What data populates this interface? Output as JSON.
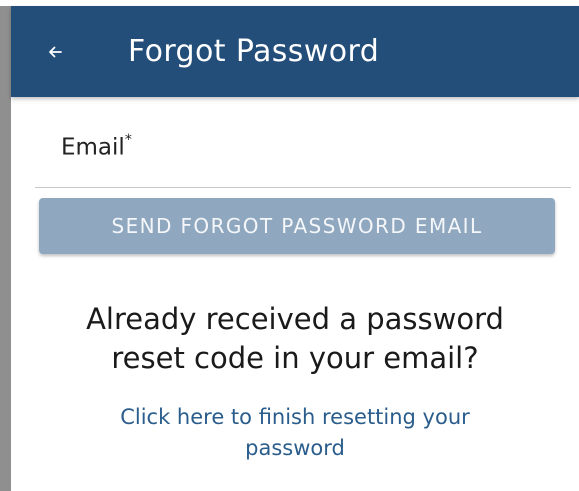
{
  "header": {
    "back_icon": "arrow-left-icon",
    "title": "Forgot Password"
  },
  "form": {
    "email_label": "Email",
    "email_required_marker": "*",
    "email_value": ""
  },
  "actions": {
    "send_button_label": "SEND FORGOT PASSWORD EMAIL"
  },
  "reset_section": {
    "heading_line1": "Already received a password",
    "heading_line2": "reset code in your email?",
    "link_line1": "Click here to finish resetting your",
    "link_line2": "password"
  },
  "colors": {
    "app_bar": "#244e7a",
    "button_disabled": "#8fa8bf",
    "link": "#2a5d8c"
  }
}
